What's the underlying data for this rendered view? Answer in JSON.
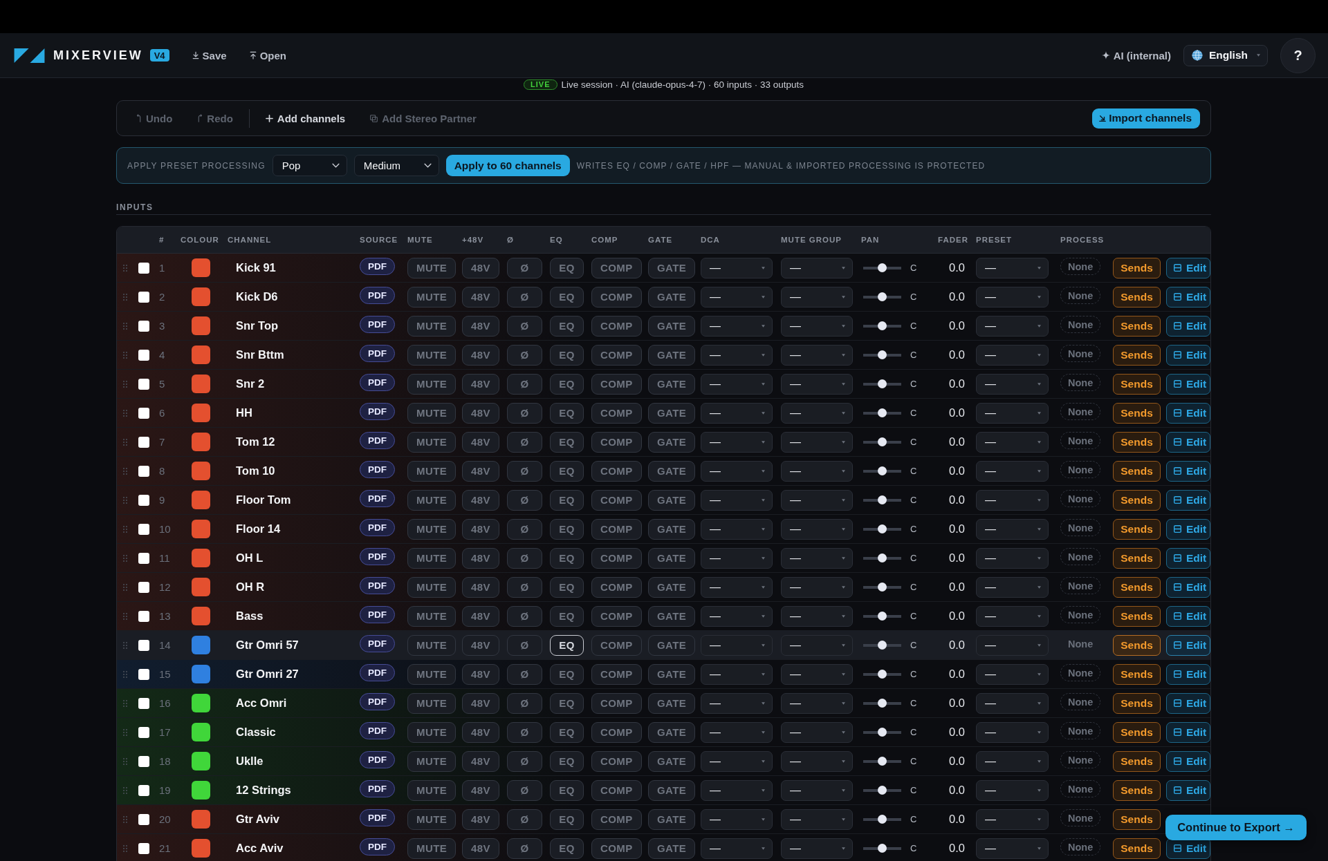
{
  "header": {
    "brand": "MIXERVIEW",
    "version": "V4",
    "actions": [
      {
        "kind": "save",
        "label": "Save"
      },
      {
        "kind": "open",
        "label": "Open"
      }
    ],
    "ai_label": "AI (internal)",
    "language": "English",
    "help": "?"
  },
  "session": {
    "badge": "LIVE",
    "text": "Live session · AI (claude-opus-4-7) · 60 inputs · 33 outputs"
  },
  "toolbar": {
    "groups": [
      [
        {
          "kind": "undo",
          "label": "Undo",
          "disabled": true
        },
        {
          "kind": "redo",
          "label": "Redo",
          "disabled": true
        }
      ],
      [
        {
          "kind": "add",
          "label": "Add channels",
          "disabled": false
        },
        {
          "kind": "stereo",
          "label": "Add Stereo Partner",
          "disabled": true
        }
      ]
    ],
    "import_label": "Import channels"
  },
  "preset_bar": {
    "label": "APPLY PRESET PROCESSING",
    "selects": [
      {
        "value": "Pop"
      },
      {
        "value": "Medium"
      }
    ],
    "apply_label": "Apply to 60 channels",
    "note": "WRITES EQ / COMP / GATE / HPF — MANUAL & IMPORTED PROCESSING IS PROTECTED"
  },
  "section": {
    "title": "INPUTS"
  },
  "table": {
    "columns": [
      "#",
      "COLOUR",
      "CHANNEL",
      "SOURCE",
      "MUTE",
      "+48V",
      "Ø",
      "EQ",
      "COMP",
      "GATE",
      "DCA",
      "MUTE GROUP",
      "PAN",
      "FADER",
      "PRESET",
      "PROCESS"
    ],
    "rows": [
      {
        "number": "1",
        "color": "#e4502f",
        "checked": false,
        "highlighted": false,
        "name": "Kick 91",
        "source": "PDF",
        "toggles": [
          {
            "label": "MUTE",
            "focused": false
          },
          {
            "label": "48V",
            "focused": false
          },
          {
            "label": "Ø",
            "focused": false
          },
          {
            "label": "EQ",
            "focused": false
          },
          {
            "label": "COMP",
            "focused": false
          },
          {
            "label": "GATE",
            "focused": false
          }
        ],
        "dca": "—",
        "mute_group": "—",
        "pan": {
          "level": 0.5,
          "reading": "C"
        },
        "fader": "0.0",
        "preset": "—",
        "process": "None",
        "sends": "Sends",
        "edit": "Edit"
      },
      {
        "number": "2",
        "color": "#e4502f",
        "checked": false,
        "highlighted": false,
        "name": "Kick D6",
        "source": "PDF",
        "toggles": [
          {
            "label": "MUTE",
            "focused": false
          },
          {
            "label": "48V",
            "focused": false
          },
          {
            "label": "Ø",
            "focused": false
          },
          {
            "label": "EQ",
            "focused": false
          },
          {
            "label": "COMP",
            "focused": false
          },
          {
            "label": "GATE",
            "focused": false
          }
        ],
        "dca": "—",
        "mute_group": "—",
        "pan": {
          "level": 0.5,
          "reading": "C"
        },
        "fader": "0.0",
        "preset": "—",
        "process": "None",
        "sends": "Sends",
        "edit": "Edit"
      },
      {
        "number": "3",
        "color": "#e4502f",
        "checked": false,
        "highlighted": false,
        "name": "Snr Top",
        "source": "PDF",
        "toggles": [
          {
            "label": "MUTE",
            "focused": false
          },
          {
            "label": "48V",
            "focused": false
          },
          {
            "label": "Ø",
            "focused": false
          },
          {
            "label": "EQ",
            "focused": false
          },
          {
            "label": "COMP",
            "focused": false
          },
          {
            "label": "GATE",
            "focused": false
          }
        ],
        "dca": "—",
        "mute_group": "—",
        "pan": {
          "level": 0.5,
          "reading": "C"
        },
        "fader": "0.0",
        "preset": "—",
        "process": "None",
        "sends": "Sends",
        "edit": "Edit"
      },
      {
        "number": "4",
        "color": "#e4502f",
        "checked": false,
        "highlighted": false,
        "name": "Snr Bttm",
        "source": "PDF",
        "toggles": [
          {
            "label": "MUTE",
            "focused": false
          },
          {
            "label": "48V",
            "focused": false
          },
          {
            "label": "Ø",
            "focused": false
          },
          {
            "label": "EQ",
            "focused": false
          },
          {
            "label": "COMP",
            "focused": false
          },
          {
            "label": "GATE",
            "focused": false
          }
        ],
        "dca": "—",
        "mute_group": "—",
        "pan": {
          "level": 0.5,
          "reading": "C"
        },
        "fader": "0.0",
        "preset": "—",
        "process": "None",
        "sends": "Sends",
        "edit": "Edit"
      },
      {
        "number": "5",
        "color": "#e4502f",
        "checked": false,
        "highlighted": false,
        "name": "Snr 2",
        "source": "PDF",
        "toggles": [
          {
            "label": "MUTE",
            "focused": false
          },
          {
            "label": "48V",
            "focused": false
          },
          {
            "label": "Ø",
            "focused": false
          },
          {
            "label": "EQ",
            "focused": false
          },
          {
            "label": "COMP",
            "focused": false
          },
          {
            "label": "GATE",
            "focused": false
          }
        ],
        "dca": "—",
        "mute_group": "—",
        "pan": {
          "level": 0.5,
          "reading": "C"
        },
        "fader": "0.0",
        "preset": "—",
        "process": "None",
        "sends": "Sends",
        "edit": "Edit"
      },
      {
        "number": "6",
        "color": "#e4502f",
        "checked": false,
        "highlighted": false,
        "name": "HH",
        "source": "PDF",
        "toggles": [
          {
            "label": "MUTE",
            "focused": false
          },
          {
            "label": "48V",
            "focused": false
          },
          {
            "label": "Ø",
            "focused": false
          },
          {
            "label": "EQ",
            "focused": false
          },
          {
            "label": "COMP",
            "focused": false
          },
          {
            "label": "GATE",
            "focused": false
          }
        ],
        "dca": "—",
        "mute_group": "—",
        "pan": {
          "level": 0.5,
          "reading": "C"
        },
        "fader": "0.0",
        "preset": "—",
        "process": "None",
        "sends": "Sends",
        "edit": "Edit"
      },
      {
        "number": "7",
        "color": "#e4502f",
        "checked": false,
        "highlighted": false,
        "name": "Tom 12",
        "source": "PDF",
        "toggles": [
          {
            "label": "MUTE",
            "focused": false
          },
          {
            "label": "48V",
            "focused": false
          },
          {
            "label": "Ø",
            "focused": false
          },
          {
            "label": "EQ",
            "focused": false
          },
          {
            "label": "COMP",
            "focused": false
          },
          {
            "label": "GATE",
            "focused": false
          }
        ],
        "dca": "—",
        "mute_group": "—",
        "pan": {
          "level": 0.5,
          "reading": "C"
        },
        "fader": "0.0",
        "preset": "—",
        "process": "None",
        "sends": "Sends",
        "edit": "Edit"
      },
      {
        "number": "8",
        "color": "#e4502f",
        "checked": false,
        "highlighted": false,
        "name": "Tom 10",
        "source": "PDF",
        "toggles": [
          {
            "label": "MUTE",
            "focused": false
          },
          {
            "label": "48V",
            "focused": false
          },
          {
            "label": "Ø",
            "focused": false
          },
          {
            "label": "EQ",
            "focused": false
          },
          {
            "label": "COMP",
            "focused": false
          },
          {
            "label": "GATE",
            "focused": false
          }
        ],
        "dca": "—",
        "mute_group": "—",
        "pan": {
          "level": 0.5,
          "reading": "C"
        },
        "fader": "0.0",
        "preset": "—",
        "process": "None",
        "sends": "Sends",
        "edit": "Edit"
      },
      {
        "number": "9",
        "color": "#e4502f",
        "checked": false,
        "highlighted": false,
        "name": "Floor Tom",
        "source": "PDF",
        "toggles": [
          {
            "label": "MUTE",
            "focused": false
          },
          {
            "label": "48V",
            "focused": false
          },
          {
            "label": "Ø",
            "focused": false
          },
          {
            "label": "EQ",
            "focused": false
          },
          {
            "label": "COMP",
            "focused": false
          },
          {
            "label": "GATE",
            "focused": false
          }
        ],
        "dca": "—",
        "mute_group": "—",
        "pan": {
          "level": 0.5,
          "reading": "C"
        },
        "fader": "0.0",
        "preset": "—",
        "process": "None",
        "sends": "Sends",
        "edit": "Edit"
      },
      {
        "number": "10",
        "color": "#e4502f",
        "checked": false,
        "highlighted": false,
        "name": "Floor 14",
        "source": "PDF",
        "toggles": [
          {
            "label": "MUTE",
            "focused": false
          },
          {
            "label": "48V",
            "focused": false
          },
          {
            "label": "Ø",
            "focused": false
          },
          {
            "label": "EQ",
            "focused": false
          },
          {
            "label": "COMP",
            "focused": false
          },
          {
            "label": "GATE",
            "focused": false
          }
        ],
        "dca": "—",
        "mute_group": "—",
        "pan": {
          "level": 0.5,
          "reading": "C"
        },
        "fader": "0.0",
        "preset": "—",
        "process": "None",
        "sends": "Sends",
        "edit": "Edit"
      },
      {
        "number": "11",
        "color": "#e4502f",
        "checked": false,
        "highlighted": false,
        "name": "OH L",
        "source": "PDF",
        "toggles": [
          {
            "label": "MUTE",
            "focused": false
          },
          {
            "label": "48V",
            "focused": false
          },
          {
            "label": "Ø",
            "focused": false
          },
          {
            "label": "EQ",
            "focused": false
          },
          {
            "label": "COMP",
            "focused": false
          },
          {
            "label": "GATE",
            "focused": false
          }
        ],
        "dca": "—",
        "mute_group": "—",
        "pan": {
          "level": 0.5,
          "reading": "C"
        },
        "fader": "0.0",
        "preset": "—",
        "process": "None",
        "sends": "Sends",
        "edit": "Edit"
      },
      {
        "number": "12",
        "color": "#e4502f",
        "checked": false,
        "highlighted": false,
        "name": "OH R",
        "source": "PDF",
        "toggles": [
          {
            "label": "MUTE",
            "focused": false
          },
          {
            "label": "48V",
            "focused": false
          },
          {
            "label": "Ø",
            "focused": false
          },
          {
            "label": "EQ",
            "focused": false
          },
          {
            "label": "COMP",
            "focused": false
          },
          {
            "label": "GATE",
            "focused": false
          }
        ],
        "dca": "—",
        "mute_group": "—",
        "pan": {
          "level": 0.5,
          "reading": "C"
        },
        "fader": "0.0",
        "preset": "—",
        "process": "None",
        "sends": "Sends",
        "edit": "Edit"
      },
      {
        "number": "13",
        "color": "#e4502f",
        "checked": false,
        "highlighted": false,
        "name": "Bass",
        "source": "PDF",
        "toggles": [
          {
            "label": "MUTE",
            "focused": false
          },
          {
            "label": "48V",
            "focused": false
          },
          {
            "label": "Ø",
            "focused": false
          },
          {
            "label": "EQ",
            "focused": false
          },
          {
            "label": "COMP",
            "focused": false
          },
          {
            "label": "GATE",
            "focused": false
          }
        ],
        "dca": "—",
        "mute_group": "—",
        "pan": {
          "level": 0.5,
          "reading": "C"
        },
        "fader": "0.0",
        "preset": "—",
        "process": "None",
        "sends": "Sends",
        "edit": "Edit"
      },
      {
        "number": "14",
        "color": "#2f80e0",
        "checked": false,
        "highlighted": true,
        "name": "Gtr Omri 57",
        "source": "PDF",
        "toggles": [
          {
            "label": "MUTE",
            "focused": false
          },
          {
            "label": "48V",
            "focused": false
          },
          {
            "label": "Ø",
            "focused": false
          },
          {
            "label": "EQ",
            "focused": true
          },
          {
            "label": "COMP",
            "focused": false
          },
          {
            "label": "GATE",
            "focused": false
          }
        ],
        "dca": "—",
        "mute_group": "—",
        "pan": {
          "level": 0.5,
          "reading": "C"
        },
        "fader": "0.0",
        "preset": "—",
        "process": "None",
        "sends": "Sends",
        "edit": "Edit"
      },
      {
        "number": "15",
        "color": "#2f80e0",
        "checked": false,
        "highlighted": false,
        "name": "Gtr Omri 27",
        "source": "PDF",
        "toggles": [
          {
            "label": "MUTE",
            "focused": false
          },
          {
            "label": "48V",
            "focused": false
          },
          {
            "label": "Ø",
            "focused": false
          },
          {
            "label": "EQ",
            "focused": false
          },
          {
            "label": "COMP",
            "focused": false
          },
          {
            "label": "GATE",
            "focused": false
          }
        ],
        "dca": "—",
        "mute_group": "—",
        "pan": {
          "level": 0.5,
          "reading": "C"
        },
        "fader": "0.0",
        "preset": "—",
        "process": "None",
        "sends": "Sends",
        "edit": "Edit"
      },
      {
        "number": "16",
        "color": "#40d63a",
        "checked": false,
        "highlighted": false,
        "name": "Acc Omri",
        "source": "PDF",
        "toggles": [
          {
            "label": "MUTE",
            "focused": false
          },
          {
            "label": "48V",
            "focused": false
          },
          {
            "label": "Ø",
            "focused": false
          },
          {
            "label": "EQ",
            "focused": false
          },
          {
            "label": "COMP",
            "focused": false
          },
          {
            "label": "GATE",
            "focused": false
          }
        ],
        "dca": "—",
        "mute_group": "—",
        "pan": {
          "level": 0.5,
          "reading": "C"
        },
        "fader": "0.0",
        "preset": "—",
        "process": "None",
        "sends": "Sends",
        "edit": "Edit"
      },
      {
        "number": "17",
        "color": "#40d63a",
        "checked": false,
        "highlighted": false,
        "name": "Classic",
        "source": "PDF",
        "toggles": [
          {
            "label": "MUTE",
            "focused": false
          },
          {
            "label": "48V",
            "focused": false
          },
          {
            "label": "Ø",
            "focused": false
          },
          {
            "label": "EQ",
            "focused": false
          },
          {
            "label": "COMP",
            "focused": false
          },
          {
            "label": "GATE",
            "focused": false
          }
        ],
        "dca": "—",
        "mute_group": "—",
        "pan": {
          "level": 0.5,
          "reading": "C"
        },
        "fader": "0.0",
        "preset": "—",
        "process": "None",
        "sends": "Sends",
        "edit": "Edit"
      },
      {
        "number": "18",
        "color": "#40d63a",
        "checked": false,
        "highlighted": false,
        "name": "Uklle",
        "source": "PDF",
        "toggles": [
          {
            "label": "MUTE",
            "focused": false
          },
          {
            "label": "48V",
            "focused": false
          },
          {
            "label": "Ø",
            "focused": false
          },
          {
            "label": "EQ",
            "focused": false
          },
          {
            "label": "COMP",
            "focused": false
          },
          {
            "label": "GATE",
            "focused": false
          }
        ],
        "dca": "—",
        "mute_group": "—",
        "pan": {
          "level": 0.5,
          "reading": "C"
        },
        "fader": "0.0",
        "preset": "—",
        "process": "None",
        "sends": "Sends",
        "edit": "Edit"
      },
      {
        "number": "19",
        "color": "#40d63a",
        "checked": false,
        "highlighted": false,
        "name": "12 Strings",
        "source": "PDF",
        "toggles": [
          {
            "label": "MUTE",
            "focused": false
          },
          {
            "label": "48V",
            "focused": false
          },
          {
            "label": "Ø",
            "focused": false
          },
          {
            "label": "EQ",
            "focused": false
          },
          {
            "label": "COMP",
            "focused": false
          },
          {
            "label": "GATE",
            "focused": false
          }
        ],
        "dca": "—",
        "mute_group": "—",
        "pan": {
          "level": 0.5,
          "reading": "C"
        },
        "fader": "0.0",
        "preset": "—",
        "process": "None",
        "sends": "Sends",
        "edit": "Edit"
      },
      {
        "number": "20",
        "color": "#e4502f",
        "checked": false,
        "highlighted": false,
        "name": "Gtr Aviv",
        "source": "PDF",
        "toggles": [
          {
            "label": "MUTE",
            "focused": false
          },
          {
            "label": "48V",
            "focused": false
          },
          {
            "label": "Ø",
            "focused": false
          },
          {
            "label": "EQ",
            "focused": false
          },
          {
            "label": "COMP",
            "focused": false
          },
          {
            "label": "GATE",
            "focused": false
          }
        ],
        "dca": "—",
        "mute_group": "—",
        "pan": {
          "level": 0.5,
          "reading": "C"
        },
        "fader": "0.0",
        "preset": "—",
        "process": "None",
        "sends": "Sends"
      },
      {
        "number": "21",
        "color": "#e4502f",
        "checked": false,
        "highlighted": false,
        "name": "Acc Aviv",
        "source": "PDF",
        "toggles": [
          {
            "label": "MUTE",
            "focused": false
          },
          {
            "label": "48V",
            "focused": false
          },
          {
            "label": "Ø",
            "focused": false
          },
          {
            "label": "EQ",
            "focused": false
          },
          {
            "label": "COMP",
            "focused": false
          },
          {
            "label": "GATE",
            "focused": false
          }
        ],
        "dca": "—",
        "mute_group": "—",
        "pan": {
          "level": 0.5,
          "reading": "C"
        },
        "fader": "0.0",
        "preset": "—",
        "process": "None",
        "sends": "Sends",
        "edit": "Edit"
      }
    ]
  },
  "continue_button": {
    "label": "Continue to Export →"
  }
}
